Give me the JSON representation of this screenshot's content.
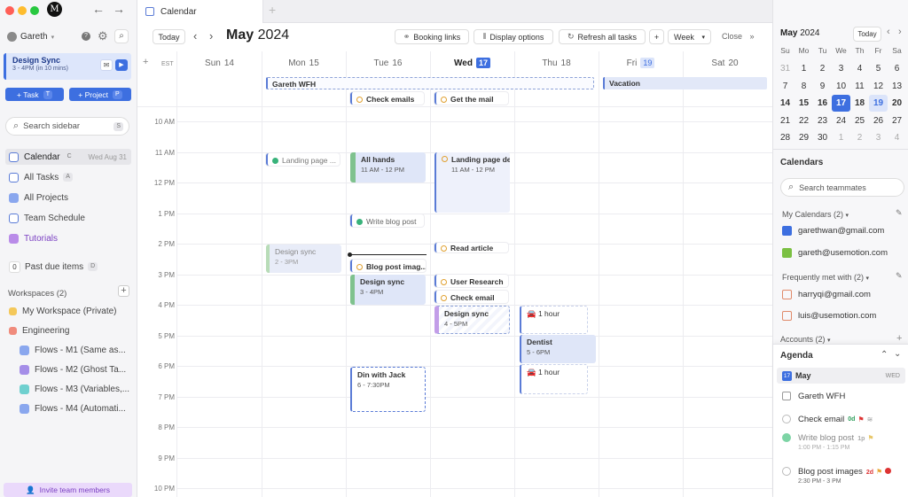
{
  "sidebar": {
    "user": "Gareth",
    "current_event": {
      "title": "Design Sync",
      "sub": "3 - 4PM (in 10 mins)"
    },
    "task_btn": "+ Task",
    "task_key": "T",
    "project_btn": "+ Project",
    "project_key": "P",
    "search_placeholder": "Search sidebar",
    "search_key": "S",
    "nav": [
      {
        "label": "Calendar",
        "key": "C",
        "extra": "Wed Aug 31"
      },
      {
        "label": "All Tasks",
        "key": "A"
      },
      {
        "label": "All Projects"
      },
      {
        "label": "Team Schedule"
      },
      {
        "label": "Tutorials"
      }
    ],
    "past_due": {
      "count": "0",
      "label": "Past due items",
      "key": "D"
    },
    "workspaces_title": "Workspaces (2)",
    "workspaces": [
      "My Workspace (Private)",
      "Engineering",
      "Flows - M1 (Same as...",
      "Flows - M2 (Ghost Ta...",
      "Flows - M3 (Variables,...",
      "Flows - M4 (Automati..."
    ],
    "invite": "Invite team members",
    "colors": {
      "accent": "#3d6fe0",
      "tutorial": "#9b59d6"
    }
  },
  "tab": {
    "label": "Calendar"
  },
  "toolbar": {
    "today": "Today",
    "month": "May",
    "year": "2024",
    "booking": "Booking links",
    "display": "Display options",
    "refresh": "Refresh all tasks",
    "plus": "+",
    "view": "Week",
    "close": "Close"
  },
  "calendar": {
    "tz": "EST",
    "days": [
      {
        "name": "Sun",
        "num": "14"
      },
      {
        "name": "Mon",
        "num": "15"
      },
      {
        "name": "Tue",
        "num": "16"
      },
      {
        "name": "Wed",
        "num": "17"
      },
      {
        "name": "Thu",
        "num": "18"
      },
      {
        "name": "Fri",
        "num": "19"
      },
      {
        "name": "Sat",
        "num": "20"
      }
    ],
    "times": [
      "10 AM",
      "11 AM",
      "12 PM",
      "1 PM",
      "2 PM",
      "3 PM",
      "4 PM",
      "5 PM",
      "6 PM",
      "7 PM",
      "8 PM",
      "9 PM",
      "10 PM"
    ],
    "allday": {
      "wfh": "Gareth WFH",
      "vacation": "Vacation"
    },
    "events": {
      "check_emails_tue": "Check emails",
      "get_mail": "Get the mail",
      "landing_mon": "Landing page ...",
      "all_hands": "All hands",
      "all_hands_time": "11 AM - 12 PM",
      "landing_wed": "Landing page des",
      "landing_wed_time": "11 AM - 12 PM",
      "write_blog": "Write blog post",
      "design_sync_mon": "Design sync",
      "design_sync_mon_time": "2 - 3PM",
      "read_article": "Read article",
      "blog_images": "Blog post imag...",
      "design_sync_tue": "Design sync",
      "design_sync_tue_time": "3 - 4PM",
      "user_research": "User Research",
      "check_email_wed": "Check email",
      "design_sync_wed": "Design sync",
      "design_sync_wed_time": "4 - 5PM",
      "hour1": "1 hour",
      "dentist": "Dentist",
      "dentist_time": "5 - 6PM",
      "hour2": "1 hour",
      "din": "Din with Jack",
      "din_time": "6 - 7:30PM"
    }
  },
  "right": {
    "mini_month": "May",
    "mini_year": "2024",
    "today_btn": "Today",
    "dow": [
      "Su",
      "Mo",
      "Tu",
      "We",
      "Th",
      "Fr",
      "Sa"
    ],
    "weeks": [
      [
        "31",
        "1",
        "2",
        "3",
        "4",
        "5",
        "6"
      ],
      [
        "7",
        "8",
        "9",
        "10",
        "11",
        "12",
        "13"
      ],
      [
        "14",
        "15",
        "16",
        "17",
        "18",
        "19",
        "20"
      ],
      [
        "21",
        "22",
        "23",
        "24",
        "25",
        "26",
        "27"
      ],
      [
        "28",
        "29",
        "30",
        "1",
        "2",
        "3",
        "4"
      ]
    ],
    "calendars_title": "Calendars",
    "search_teammates": "Search teammates",
    "my_calendars": "My Calendars (2)",
    "my_cals": [
      "garethwan@gmail.com",
      "gareth@usemotion.com"
    ],
    "freq": "Frequently met with (2)",
    "freq_list": [
      "harryqi@gmail.com",
      "luis@usemotion.com"
    ],
    "accounts": "Accounts (2)",
    "agenda_title": "Agenda",
    "agenda_month": "May",
    "agenda_day_num": "17",
    "agenda_day": "WED",
    "agenda": [
      {
        "title": "Gareth WFH"
      },
      {
        "title": "Check email",
        "badge": "0d"
      },
      {
        "title": "Write blog post",
        "badge": "1p",
        "sub": "1:00 PM - 1:15 PM"
      },
      {
        "title": "Blog post images",
        "badge": "2d",
        "sub": "2:30 PM - 3 PM"
      }
    ]
  }
}
